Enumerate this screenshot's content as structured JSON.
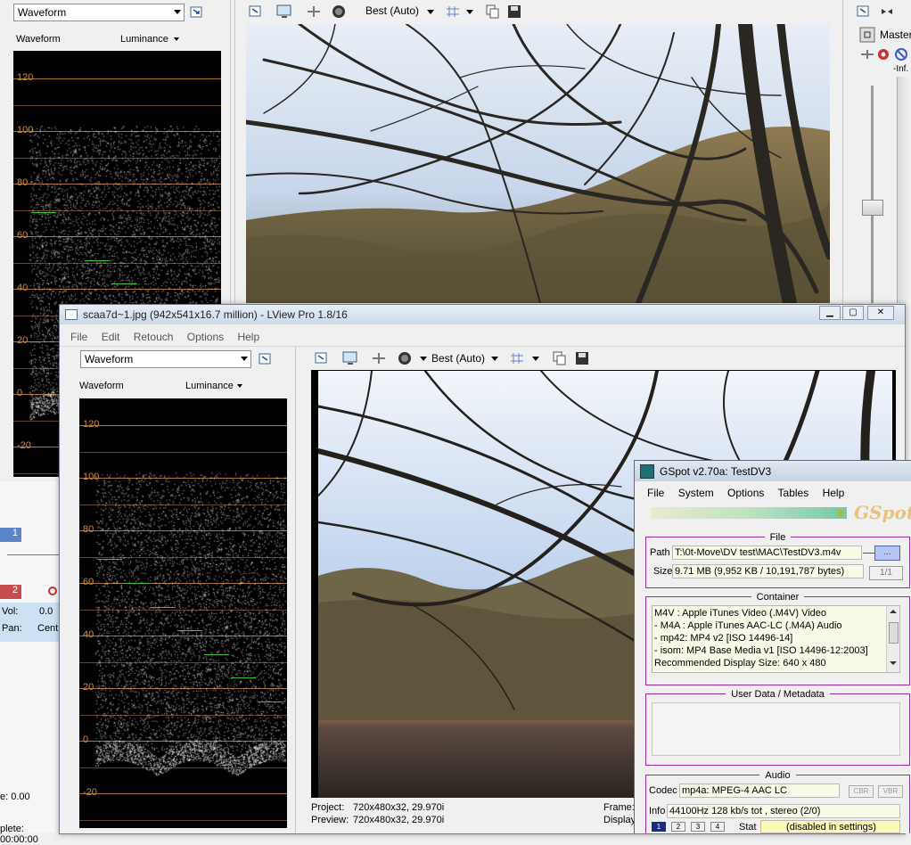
{
  "top_left": {
    "dropdown": "Waveform",
    "scope_title": "Waveform",
    "scope_mode": "Luminance",
    "ticks": [
      "120",
      "100",
      "80",
      "60",
      "40",
      "20",
      "0",
      "-20"
    ]
  },
  "top_toolbar": {
    "quality": "Best (Auto)"
  },
  "mixer": {
    "master_label": "Master",
    "inf_label": "-Inf."
  },
  "left_bottom": {
    "track_num_1": "1",
    "track_num_2": "2",
    "vol_label": "Vol:",
    "vol_value": "0.0",
    "pan_label": "Pan:",
    "pan_value": "Cent",
    "rate_label": "e: 0.00",
    "complete_label": "plete: 00:00:00"
  },
  "lview": {
    "title": "scaa7d~1.jpg (942x541x16.7 million) - LView Pro 1.8/16",
    "menu": [
      "File",
      "Edit",
      "Retouch",
      "Options",
      "Help"
    ],
    "dropdown": "Waveform",
    "scope_title": "Waveform",
    "scope_mode": "Luminance",
    "ticks": [
      "120",
      "100",
      "80",
      "60",
      "40",
      "20",
      "0",
      "-20"
    ],
    "quality": "Best (Auto)",
    "project_label": "Project:",
    "project_value": "720x480x32, 29.970i",
    "preview_label": "Preview:",
    "preview_value": "720x480x32, 29.970i",
    "frame_label": "Frame:",
    "display_label": "Display"
  },
  "gspot": {
    "title": "GSpot v2.70a: TestDV3",
    "menu": [
      "File",
      "System",
      "Options",
      "Tables",
      "Help"
    ],
    "logo": "GSpot",
    "file_legend": "File",
    "path_label": "Path",
    "path_value": "T:\\0t-Move\\DV test\\MAC\\TestDV3.m4v",
    "browse": "...",
    "size_label": "Size",
    "size_value": "9.71 MB (9,952 KB / 10,191,787 bytes)",
    "page": "1/1",
    "container_legend": "Container",
    "container_lines": [
      "M4V : Apple iTunes Video (.M4V) Video",
      "- M4A : Apple iTunes AAC-LC (.M4A) Audio",
      "- mp42: MP4 v2 [ISO 14496-14]",
      "- isom: MP4  Base Media v1 [ISO 14496-12:2003]",
      "Recommended Display Size: 640 x 480"
    ],
    "userdata_legend": "User Data / Metadata",
    "audio_legend": "Audio",
    "codec_label": "Codec",
    "codec_value": "mp4a: MPEG-4 AAC LC",
    "cbr": "CBR",
    "vbr": "VBR",
    "info_label": "Info",
    "info_value": "44100Hz  128 kb/s tot , stereo (2/0)",
    "tabs": [
      "1",
      "2",
      "3",
      "4"
    ],
    "stat_label": "Stat",
    "stat_value": "(disabled in settings)"
  }
}
